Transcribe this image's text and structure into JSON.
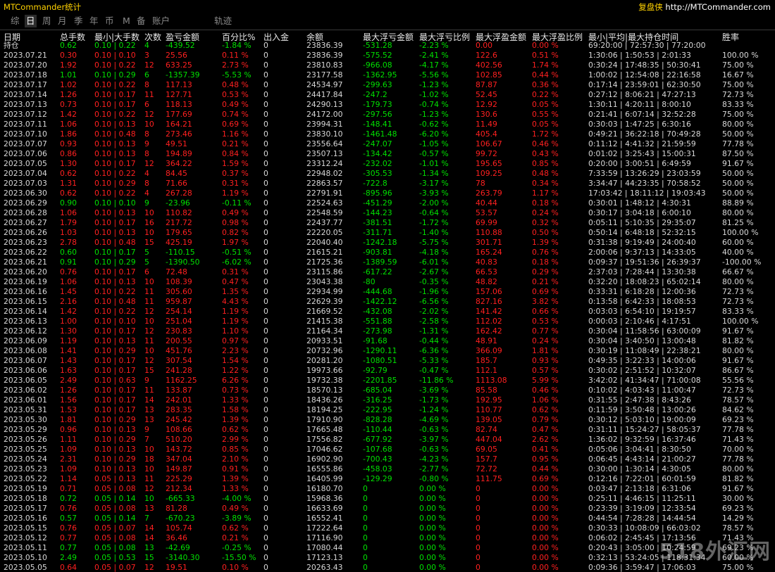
{
  "app_title": "MTCommander统计",
  "brand": {
    "name": "复盘侠",
    "url": "http://MTCommander.com"
  },
  "nav": [
    "综",
    "日",
    "周",
    "月",
    "季",
    "年",
    "币",
    "M",
    "备",
    "账户",
    "轨迹"
  ],
  "nav_active": 1,
  "columns": [
    "日期",
    "总手数",
    "最小|大手数",
    "次数",
    "盈亏金额",
    "百分比%",
    "出入金",
    "余额",
    "最大浮亏金额",
    "最大浮亏比例",
    "最大浮盈金额",
    "最大浮盈比例",
    "最小|平均|最大持仓时间",
    "胜率"
  ],
  "holding_row": {
    "label": "持仓",
    "total_lots": "0.62",
    "lots": "0.10 | 0.22",
    "count": "4",
    "pnl": "-439.52",
    "pct": "-1.84 %",
    "deposit": "0",
    "balance": "23836.39",
    "max_float_loss": "-531.28",
    "max_float_loss_pct": "-2.23 %",
    "max_float_profit": "0.00",
    "max_float_profit_pct": "0.00 %",
    "hold_time": "69:20:00 | 72:57:30 | 77:20:00",
    "win_rate": ""
  },
  "rows": [
    [
      "2023.07.21",
      "0.30",
      "0.10 | 0.10",
      "3",
      "25.56",
      "0.11 %",
      "0",
      "23836.39",
      "-575.52",
      "-2.41 %",
      "122.6",
      "0.51 %",
      "1:30:06 | 1:50:53 | 2:01:33",
      "100.00 %"
    ],
    [
      "2023.07.20",
      "1.92",
      "0.10 | 0.22",
      "12",
      "633.25",
      "2.73 %",
      "0",
      "23810.83",
      "-966.08",
      "-4.17 %",
      "402.56",
      "1.74 %",
      "0:30:24 | 17:48:35 | 50:30:41",
      "75.00 %"
    ],
    [
      "2023.07.18",
      "1.01",
      "0.10 | 0.29",
      "6",
      "-1357.39",
      "-5.53 %",
      "0",
      "23177.58",
      "-1362.95",
      "-5.56 %",
      "102.85",
      "0.44 %",
      "1:00:02 | 12:54:08 | 22:16:58",
      "16.67 %"
    ],
    [
      "2023.07.17",
      "1.02",
      "0.10 | 0.22",
      "8",
      "117.13",
      "0.48 %",
      "0",
      "24534.97",
      "-299.63",
      "-1.23 %",
      "87.87",
      "0.36 %",
      "0:17:14 | 23:59:01 | 62:30:50",
      "75.00 %"
    ],
    [
      "2023.07.14",
      "1.26",
      "0.10 | 0.17",
      "11",
      "127.71",
      "0.53 %",
      "0",
      "24417.84",
      "-247.2",
      "-1.02 %",
      "52.45",
      "0.22 %",
      "0:27:12 | 8:06:21 | 47:27:13",
      "72.73 %"
    ],
    [
      "2023.07.13",
      "0.73",
      "0.10 | 0.17",
      "6",
      "118.13",
      "0.49 %",
      "0",
      "24290.13",
      "-179.73",
      "-0.74 %",
      "12.92",
      "0.05 %",
      "1:30:11 | 4:20:11 | 8:00:10",
      "83.33 %"
    ],
    [
      "2023.07.12",
      "1.42",
      "0.10 | 0.22",
      "12",
      "177.69",
      "0.74 %",
      "0",
      "24172.00",
      "-297.56",
      "-1.23 %",
      "130.6",
      "0.55 %",
      "0:21:41 | 6:07:14 | 32:52:28",
      "75.00 %"
    ],
    [
      "2023.07.11",
      "1.06",
      "0.10 | 0.13",
      "10",
      "164.21",
      "0.69 %",
      "0",
      "23994.31",
      "-148.41",
      "-0.62 %",
      "11.49",
      "0.05 %",
      "0:30:03 | 1:47:25 | 6:30:16",
      "80.00 %"
    ],
    [
      "2023.07.10",
      "1.86",
      "0.10 | 0.48",
      "8",
      "273.46",
      "1.16 %",
      "0",
      "23830.10",
      "-1461.48",
      "-6.20 %",
      "405.4",
      "1.72 %",
      "0:49:21 | 36:22:18 | 70:49:28",
      "50.00 %"
    ],
    [
      "2023.07.07",
      "0.93",
      "0.10 | 0.13",
      "9",
      "49.51",
      "0.21 %",
      "0",
      "23556.64",
      "-247.07",
      "-1.05 %",
      "106.67",
      "0.46 %",
      "0:11:12 | 4:41:32 | 21:59:59",
      "77.78 %"
    ],
    [
      "2023.07.06",
      "0.86",
      "0.10 | 0.13",
      "8",
      "194.89",
      "0.84 %",
      "0",
      "23507.13",
      "-134.42",
      "-0.57 %",
      "99.72",
      "0.43 %",
      "0:01:02 | 3:25:43 | 15:00:31",
      "87.50 %"
    ],
    [
      "2023.07.05",
      "1.30",
      "0.10 | 0.17",
      "12",
      "364.22",
      "1.59 %",
      "0",
      "23312.24",
      "-232.02",
      "-1.01 %",
      "195.65",
      "0.85 %",
      "0:20:00 | 3:00:51 | 6:49:59",
      "91.67 %"
    ],
    [
      "2023.07.04",
      "0.62",
      "0.10 | 0.22",
      "4",
      "84.45",
      "0.37 %",
      "0",
      "22948.02",
      "-305.53",
      "-1.34 %",
      "109.25",
      "0.48 %",
      "7:33:59 | 13:26:29 | 23:03:59",
      "50.00 %"
    ],
    [
      "2023.07.03",
      "1.31",
      "0.10 | 0.29",
      "8",
      "71.66",
      "0.31 %",
      "0",
      "22863.57",
      "-722.8",
      "-3.17 %",
      "78",
      "0.34 %",
      "3:34:47 | 44:23:35 | 70:58:52",
      "50.00 %"
    ],
    [
      "2023.06.30",
      "0.62",
      "0.10 | 0.22",
      "4",
      "267.28",
      "1.19 %",
      "0",
      "22791.91",
      "-895.96",
      "-3.93 %",
      "263.79",
      "1.17 %",
      "17:03:42 | 18:11:12 | 19:03:43",
      "50.00 %"
    ],
    [
      "2023.06.29",
      "0.90",
      "0.10 | 0.10",
      "9",
      "-23.96",
      "-0.11 %",
      "0",
      "22524.63",
      "-451.29",
      "-2.00 %",
      "40.44",
      "0.18 %",
      "0:30:01 | 1:48:12 | 4:30:31",
      "88.89 %"
    ],
    [
      "2023.06.28",
      "1.06",
      "0.10 | 0.13",
      "10",
      "110.82",
      "0.49 %",
      "0",
      "22548.59",
      "-144.23",
      "-0.64 %",
      "53.57",
      "0.24 %",
      "0:30:17 | 3:04:18 | 6:00:10",
      "80.00 %"
    ],
    [
      "2023.06.27",
      "1.79",
      "0.10 | 0.17",
      "16",
      "217.72",
      "0.98 %",
      "0",
      "22437.77",
      "-381.51",
      "-1.72 %",
      "69.99",
      "0.32 %",
      "0:05:11 | 5:10:35 | 29:35:07",
      "81.25 %"
    ],
    [
      "2023.06.26",
      "1.03",
      "0.10 | 0.13",
      "10",
      "179.65",
      "0.82 %",
      "0",
      "22220.05",
      "-311.71",
      "-1.40 %",
      "110.88",
      "0.50 %",
      "0:50:14 | 6:48:18 | 52:32:15",
      "100.00 %"
    ],
    [
      "2023.06.23",
      "2.78",
      "0.10 | 0.48",
      "15",
      "425.19",
      "1.97 %",
      "0",
      "22040.40",
      "-1242.18",
      "-5.75 %",
      "301.71",
      "1.39 %",
      "0:31:38 | 9:19:49 | 24:00:40",
      "60.00 %"
    ],
    [
      "2023.06.22",
      "0.60",
      "0.10 | 0.17",
      "5",
      "-110.15",
      "-0.51 %",
      "0",
      "21615.21",
      "-903.81",
      "-4.18 %",
      "165.24",
      "0.76 %",
      "2:00:06 | 9:37:13 | 14:33:05",
      "40.00 %"
    ],
    [
      "2023.06.21",
      "0.91",
      "0.10 | 0.29",
      "5",
      "-1390.50",
      "-6.02 %",
      "0",
      "21725.36",
      "-1389.59",
      "-6.01 %",
      "40.83",
      "0.18 %",
      "0:09:37 | 19:51:36 | 26:39:37",
      "-100.00 %"
    ],
    [
      "2023.06.20",
      "0.76",
      "0.10 | 0.17",
      "6",
      "72.48",
      "0.31 %",
      "0",
      "23115.86",
      "-617.22",
      "-2.67 %",
      "66.53",
      "0.29 %",
      "2:37:03 | 7:28:44 | 13:30:38",
      "66.67 %"
    ],
    [
      "2023.06.19",
      "1.06",
      "0.10 | 0.13",
      "10",
      "108.39",
      "0.47 %",
      "0",
      "23043.38",
      "-80",
      "-0.35 %",
      "48.82",
      "0.21 %",
      "0:32:20 | 18:08:23 | 65:02:14",
      "80.00 %"
    ],
    [
      "2023.06.16",
      "1.45",
      "0.10 | 0.22",
      "11",
      "305.60",
      "1.35 %",
      "0",
      "22934.99",
      "-444.68",
      "-1.96 %",
      "157.06",
      "0.69 %",
      "0:33:31 | 6:18:28 | 12:00:36",
      "72.73 %"
    ],
    [
      "2023.06.15",
      "2.16",
      "0.10 | 0.48",
      "11",
      "959.87",
      "4.43 %",
      "0",
      "22629.39",
      "-1422.12",
      "-6.56 %",
      "827.16",
      "3.82 %",
      "0:13:58 | 6:42:33 | 18:08:53",
      "72.73 %"
    ],
    [
      "2023.06.14",
      "1.42",
      "0.10 | 0.22",
      "12",
      "254.14",
      "1.19 %",
      "0",
      "21669.52",
      "-432.08",
      "-2.02 %",
      "141.42",
      "0.66 %",
      "0:03:03 | 6:54:10 | 19:19:57",
      "83.33 %"
    ],
    [
      "2023.06.13",
      "1.00",
      "0.10 | 0.10",
      "10",
      "251.04",
      "1.19 %",
      "0",
      "21415.38",
      "-551.88",
      "-2.58 %",
      "112.02",
      "0.53 %",
      "0:00:03 | 2:10:46 | 4:17:51",
      "100.00 %"
    ],
    [
      "2023.06.12",
      "1.30",
      "0.10 | 0.17",
      "12",
      "230.83",
      "1.10 %",
      "0",
      "21164.34",
      "-273.98",
      "-1.31 %",
      "162.42",
      "0.77 %",
      "0:30:04 | 11:58:56 | 63:00:09",
      "91.67 %"
    ],
    [
      "2023.06.09",
      "1.19",
      "0.10 | 0.13",
      "11",
      "200.55",
      "0.97 %",
      "0",
      "20933.51",
      "-91.68",
      "-0.44 %",
      "48.91",
      "0.24 %",
      "0:30:04 | 3:40:50 | 13:00:48",
      "81.82 %"
    ],
    [
      "2023.06.08",
      "1.41",
      "0.10 | 0.29",
      "10",
      "451.76",
      "2.23 %",
      "0",
      "20732.96",
      "-1290.11",
      "-6.36 %",
      "366.09",
      "1.81 %",
      "0:30:19 | 11:08:49 | 22:38:21",
      "80.00 %"
    ],
    [
      "2023.06.07",
      "1.43",
      "0.10 | 0.17",
      "12",
      "307.54",
      "1.54 %",
      "0",
      "20281.20",
      "-1080.51",
      "-5.33 %",
      "185.7",
      "0.93 %",
      "0:49:35 | 3:22:33 | 14:00:06",
      "91.67 %"
    ],
    [
      "2023.06.06",
      "1.63",
      "0.10 | 0.17",
      "15",
      "241.28",
      "1.22 %",
      "0",
      "19973.66",
      "-92.79",
      "-0.47 %",
      "112.1",
      "0.57 %",
      "0:30:02 | 2:51:52 | 10:32:07",
      "86.67 %"
    ],
    [
      "2023.06.05",
      "2.49",
      "0.10 | 0.63",
      "9",
      "1162.25",
      "6.26 %",
      "0",
      "19732.38",
      "-2201.85",
      "-11.86 %",
      "1113.08",
      "5.99 %",
      "3:42:02 | 41:34:47 | 71:00:08",
      "55.56 %"
    ],
    [
      "2023.06.02",
      "1.26",
      "0.10 | 0.17",
      "11",
      "133.87",
      "0.73 %",
      "0",
      "18570.13",
      "-685.04",
      "-3.69 %",
      "85.58",
      "0.46 %",
      "0:10:02 | 4:03:43 | 11:00:47",
      "72.73 %"
    ],
    [
      "2023.06.01",
      "1.56",
      "0.10 | 0.17",
      "14",
      "242.01",
      "1.33 %",
      "0",
      "18436.26",
      "-316.25",
      "-1.73 %",
      "192.95",
      "1.06 %",
      "0:31:55 | 2:47:38 | 8:43:26",
      "78.57 %"
    ],
    [
      "2023.05.31",
      "1.53",
      "0.10 | 0.17",
      "13",
      "283.35",
      "1.58 %",
      "0",
      "18194.25",
      "-222.95",
      "-1.24 %",
      "110.77",
      "0.62 %",
      "0:11:59 | 3:50:48 | 13:00:26",
      "84.62 %"
    ],
    [
      "2023.05.30",
      "1.81",
      "0.10 | 0.29",
      "13",
      "245.42",
      "1.39 %",
      "0",
      "17910.90",
      "-828.28",
      "-4.69 %",
      "139.05",
      "0.79 %",
      "0:30:12 | 5:03:10 | 19:00:09",
      "69.23 %"
    ],
    [
      "2023.05.29",
      "0.96",
      "0.10 | 0.13",
      "9",
      "108.66",
      "0.62 %",
      "0",
      "17665.48",
      "-110.44",
      "-0.63 %",
      "82.74",
      "0.47 %",
      "0:31:11 | 15:24:27 | 58:05:37",
      "77.78 %"
    ],
    [
      "2023.05.26",
      "1.11",
      "0.10 | 0.29",
      "7",
      "510.20",
      "2.99 %",
      "0",
      "17556.82",
      "-677.92",
      "-3.97 %",
      "447.04",
      "2.62 %",
      "1:36:02 | 9:32:59 | 16:37:46",
      "71.43 %"
    ],
    [
      "2023.05.25",
      "1.09",
      "0.10 | 0.13",
      "10",
      "143.72",
      "0.85 %",
      "0",
      "17046.62",
      "-107.68",
      "-0.63 %",
      "69.05",
      "0.41 %",
      "0:05:06 | 3:04:41 | 8:30:50",
      "70.00 %"
    ],
    [
      "2023.05.24",
      "2.31",
      "0.10 | 0.29",
      "18",
      "347.04",
      "2.10 %",
      "0",
      "16902.90",
      "-700.43",
      "-4.23 %",
      "157.7",
      "0.95 %",
      "0:06:45 | 4:43:14 | 21:00:27",
      "77.78 %"
    ],
    [
      "2023.05.23",
      "1.09",
      "0.10 | 0.13",
      "10",
      "149.87",
      "0.91 %",
      "0",
      "16555.86",
      "-458.03",
      "-2.77 %",
      "72.72",
      "0.44 %",
      "0:30:00 | 1:30:14 | 4:30:05",
      "80.00 %"
    ],
    [
      "2023.05.22",
      "1.14",
      "0.05 | 0.13",
      "11",
      "225.29",
      "1.39 %",
      "0",
      "16405.99",
      "-129.29",
      "-0.80 %",
      "111.75",
      "0.69 %",
      "0:12:16 | 7:22:01 | 60:01:59",
      "81.82 %"
    ],
    [
      "2023.05.19",
      "0.71",
      "0.05 | 0.08",
      "12",
      "212.34",
      "1.33 %",
      "0",
      "16180.70",
      "0",
      "0.00 %",
      "0",
      "0.00 %",
      "0:03:47 | 2:13:18 | 6:31:06",
      "91.67 %"
    ],
    [
      "2023.05.18",
      "0.72",
      "0.05 | 0.14",
      "10",
      "-665.33",
      "-4.00 %",
      "0",
      "15968.36",
      "0",
      "0.00 %",
      "0",
      "0.00 %",
      "0:25:11 | 4:46:15 | 11:25:11",
      "30.00 %"
    ],
    [
      "2023.05.17",
      "0.76",
      "0.05 | 0.08",
      "13",
      "81.28",
      "0.49 %",
      "0",
      "16633.69",
      "0",
      "0.00 %",
      "0",
      "0.00 %",
      "0:23:39 | 3:19:09 | 12:33:54",
      "69.23 %"
    ],
    [
      "2023.05.16",
      "0.57",
      "0.05 | 0.14",
      "7",
      "-670.23",
      "-3.89 %",
      "0",
      "16552.41",
      "0",
      "0.00 %",
      "0",
      "0.00 %",
      "0:44:54 | 7:28:28 | 14:44:54",
      "14.29 %"
    ],
    [
      "2023.05.15",
      "0.76",
      "0.05 | 0.07",
      "14",
      "105.74",
      "0.62 %",
      "0",
      "17222.64",
      "0",
      "0.00 %",
      "0",
      "0.00 %",
      "0:30:33 | 10:08:09 | 66:03:02",
      "78.57 %"
    ],
    [
      "2023.05.12",
      "0.77",
      "0.05 | 0.08",
      "14",
      "36.46",
      "0.21 %",
      "0",
      "17116.90",
      "0",
      "0.00 %",
      "0",
      "0.00 %",
      "0:06:02 | 2:45:45 | 17:13:56",
      "71.43 %"
    ],
    [
      "2023.05.11",
      "0.77",
      "0.05 | 0.08",
      "13",
      "-42.69",
      "-0.25 %",
      "0",
      "17080.44",
      "0",
      "0.00 %",
      "0",
      "0.00 %",
      "0:20:43 | 3:05:00 | 10:24:59",
      "69.23 %"
    ],
    [
      "2023.05.10",
      "2.49",
      "0.05 | 0.53",
      "15",
      "-3140.30",
      "-15.50 %",
      "0",
      "17123.13",
      "0",
      "0.00 %",
      "0",
      "0.00 %",
      "0:32:13 | 53:24:05 | 118:31:34",
      "60.00 %"
    ],
    [
      "2023.05.05",
      "0.64",
      "0.05 | 0.07",
      "12",
      "19.51",
      "0.10 %",
      "0",
      "20263.43",
      "0",
      "0.00 %",
      "0",
      "0.00 %",
      "0:09:36 | 3:59:47 | 17:06:03",
      "75.00 %"
    ]
  ],
  "watermark": "518外汇网",
  "colors": {
    "profit": "#00e000",
    "loss": "#ff2020",
    "title": "#ffd200"
  }
}
